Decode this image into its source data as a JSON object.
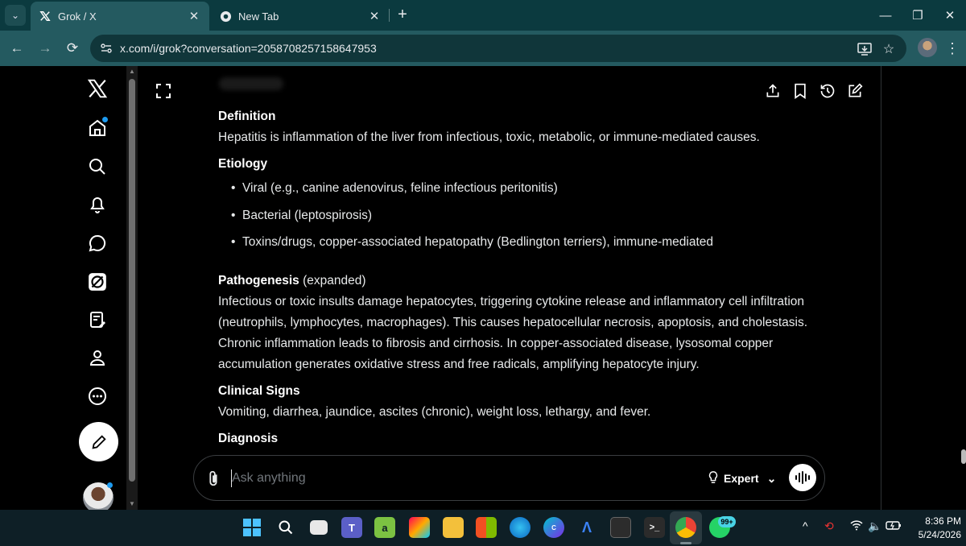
{
  "browser": {
    "tabs": [
      {
        "title": "Grok / X",
        "active": true
      },
      {
        "title": "New Tab",
        "active": false
      }
    ],
    "url": "x.com/i/grok?conversation=2058708257158647953"
  },
  "sidebar": {
    "items": [
      "x-logo",
      "home",
      "search",
      "notifications",
      "messages",
      "grok",
      "lists",
      "profile",
      "more"
    ]
  },
  "article": {
    "definition_heading": "Definition",
    "definition_text": "Hepatitis is inflammation of the liver from infectious, toxic, metabolic, or immune-mediated causes.",
    "etiology_heading": "Etiology",
    "etiology_items": [
      "Viral (e.g., canine adenovirus, feline infectious peritonitis)",
      "Bacterial (leptospirosis)",
      "Toxins/drugs, copper-associated hepatopathy (Bedlington terriers), immune-mediated"
    ],
    "pathogenesis_heading": "Pathogenesis",
    "pathogenesis_suffix": " (expanded)",
    "pathogenesis_text": "Infectious or toxic insults damage hepatocytes, triggering cytokine release and inflammatory cell infiltration (neutrophils, lymphocytes, macrophages). This causes hepatocellular necrosis, apoptosis, and cholestasis. Chronic inflammation leads to fibrosis and cirrhosis. In copper-associated disease, lysosomal copper accumulation generates oxidative stress and free radicals, amplifying hepatocyte injury.",
    "clinical_heading": "Clinical Signs",
    "clinical_text": "Vomiting, diarrhea, jaundice, ascites (chronic), weight loss, lethargy, and fever.",
    "diagnosis_heading": "Diagnosis"
  },
  "composer": {
    "placeholder": "Ask anything",
    "mode_label": "Expert"
  },
  "taskbar": {
    "badge": "99+",
    "time": "8:36 PM",
    "date": "5/24/2026"
  },
  "colors": {
    "accent": "#1d9bf0",
    "chrome_frame": "#0b3a3f",
    "chrome_toolbar": "#245a60"
  }
}
